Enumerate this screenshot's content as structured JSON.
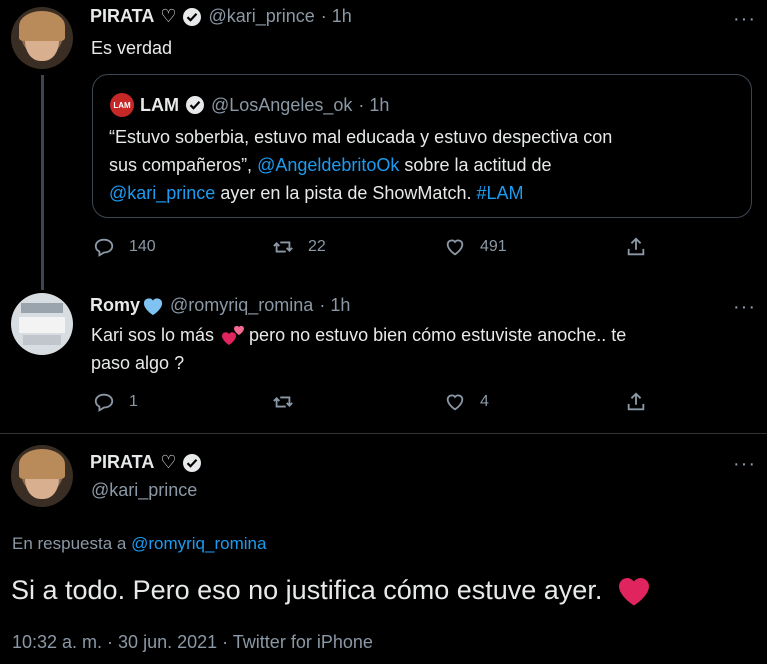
{
  "tweet1": {
    "display_name": "PIRATA",
    "heart_glyph": "♡",
    "handle": "@kari_prince",
    "time": "· 1h",
    "text": "Es verdad",
    "quote": {
      "avatar_text": "LAM",
      "display_name": "LAM",
      "handle": "@LosAngeles_ok",
      "time": "· 1h",
      "line1": "“Estuvo soberbia, estuvo mal educada y estuvo despectiva con",
      "line2_pre": "sus compañeros”, ",
      "line2_mention": "@AngeldebritoOk",
      "line2_post": " sobre la actitud de",
      "line3_mention": "@kari_prince",
      "line3_post": " ayer en la pista de ShowMatch. ",
      "line3_hashtag": "#LAM"
    },
    "replies": "140",
    "retweets": "22",
    "likes": "491"
  },
  "tweet2": {
    "display_name": "Romy",
    "handle": "@romyriq_romina",
    "time": "· 1h",
    "line1_pre": "Kari sos lo más ",
    "line1_post": "pero no estuvo bien cómo estuviste anoche.. te",
    "line2": "paso algo ?",
    "replies": "1",
    "likes": "4"
  },
  "tweet3": {
    "display_name": "PIRATA",
    "heart_glyph": "♡",
    "handle": "@kari_prince",
    "reply_prefix": "En respuesta a ",
    "reply_to": "@romyriq_romina",
    "text": "Si a todo. Pero eso no justifica cómo estuve ayer.",
    "meta": "10:32 a. m. · 30 jun. 2021 · Twitter for iPhone"
  },
  "more_glyph": "···",
  "colors": {
    "accent": "#1d9bf0",
    "muted": "#8b98a5",
    "heart": "#e0245e",
    "background": "#000000"
  }
}
